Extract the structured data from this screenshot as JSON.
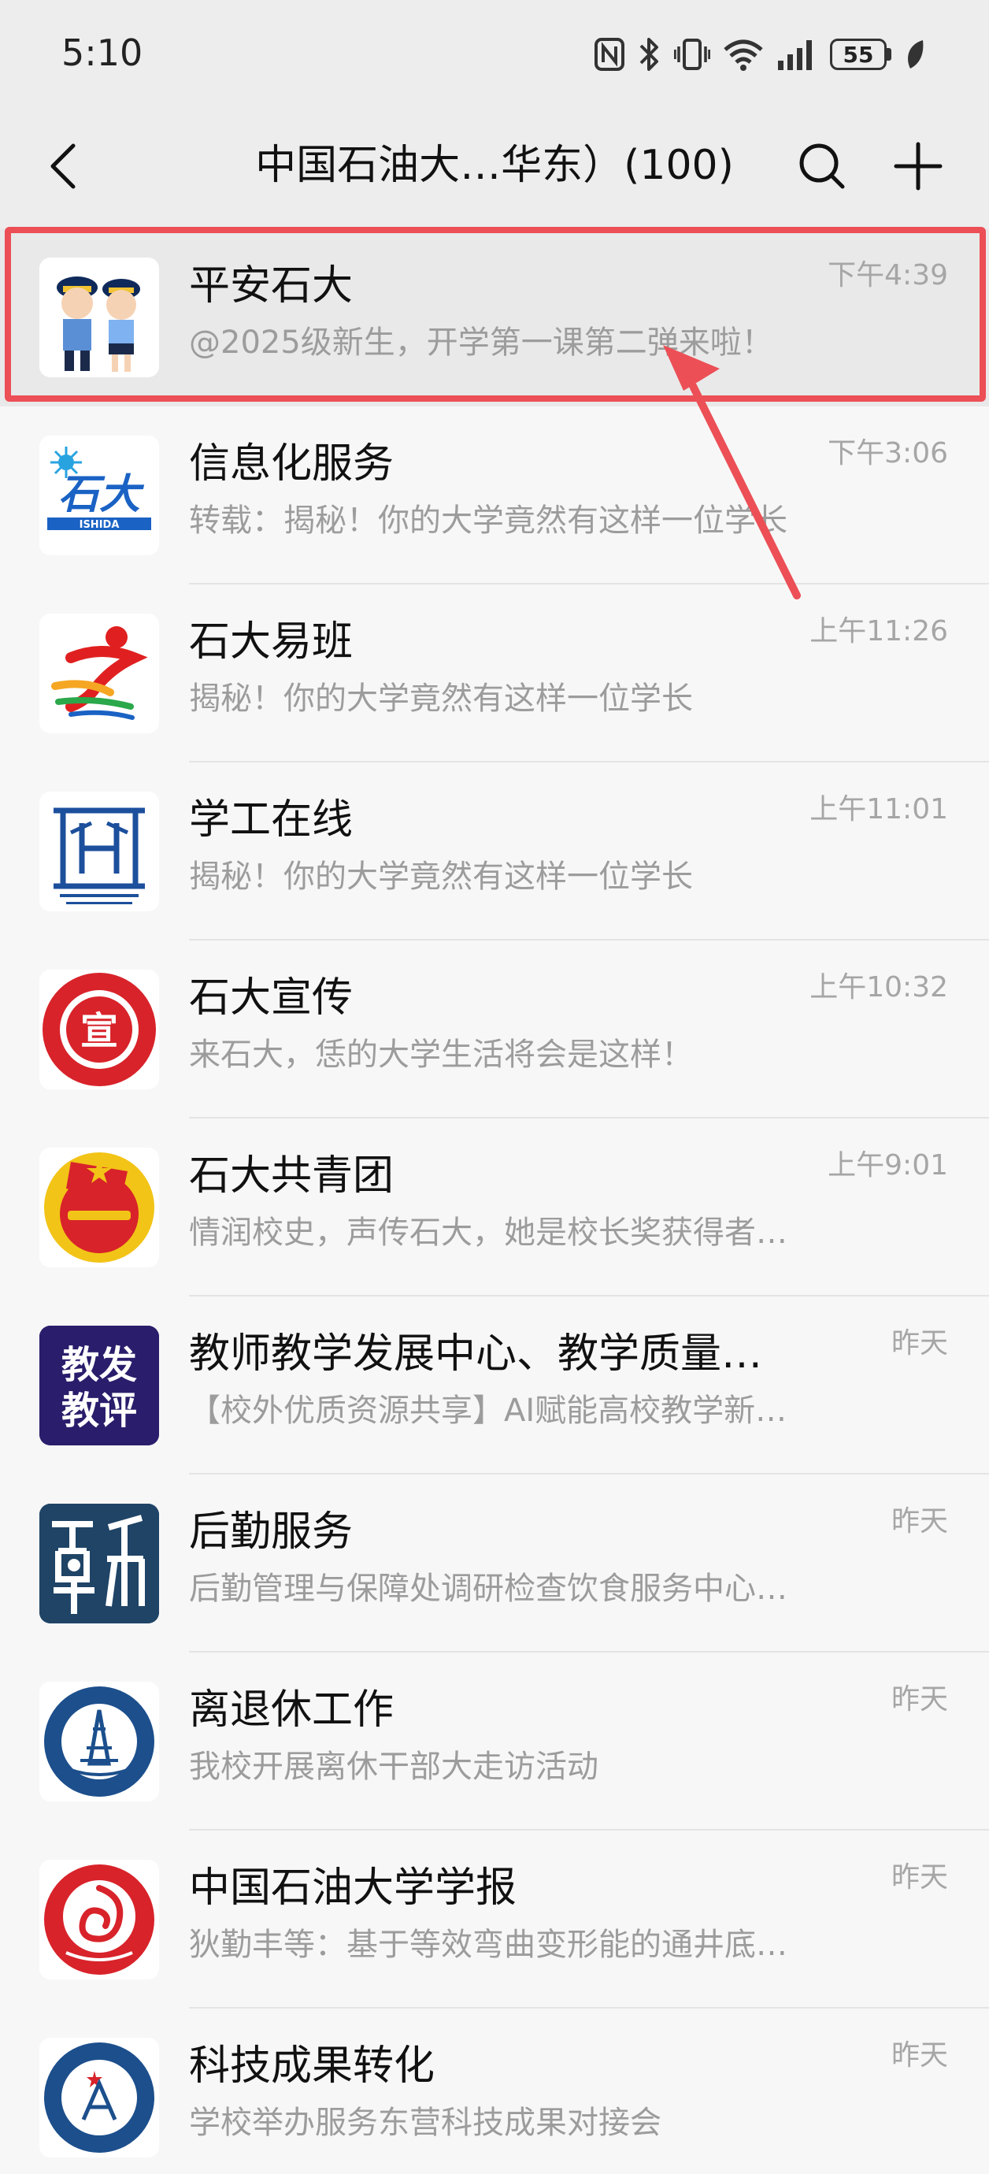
{
  "status_bar": {
    "time": "5:10",
    "battery": "55",
    "icons": [
      "nfc-icon",
      "bluetooth-icon",
      "vibrate-icon",
      "wifi-icon",
      "signal-icon",
      "battery-icon",
      "leaf-icon"
    ]
  },
  "header": {
    "title": "中国石油大…华东）(100)",
    "back_icon": "chevron-left-icon",
    "search_icon": "search-icon",
    "add_icon": "plus-icon"
  },
  "accent_colors": {
    "annotation": "#ec4f56",
    "background": "#ededed"
  },
  "accounts": [
    {
      "name": "平安石大",
      "preview": "@2025级新生，开学第一课第二弹来啦！",
      "time": "下午4:39",
      "avatar": "police-mascots-avatar"
    },
    {
      "name": "信息化服务",
      "preview": "转载：揭秘！你的大学竟然有这样一位学长",
      "time": "下午3:06",
      "avatar": "shida-logo-avatar",
      "avatar_text": "ISHIDA"
    },
    {
      "name": "石大易班",
      "preview": "揭秘！你的大学竟然有这样一位学长",
      "time": "上午11:26",
      "avatar": "runner-logo-avatar"
    },
    {
      "name": "学工在线",
      "preview": "揭秘！你的大学竟然有这样一位学长",
      "time": "上午11:01",
      "avatar": "xuegong-logo-avatar"
    },
    {
      "name": "石大宣传",
      "preview": "来石大，恁的大学生活将会是这样！",
      "time": "上午10:32",
      "avatar": "university-seal-avatar",
      "avatar_text": "宣"
    },
    {
      "name": "石大共青团",
      "preview": "情润校史，声传石大，她是校长奖获得者…",
      "time": "上午9:01",
      "avatar": "youth-league-avatar"
    },
    {
      "name": "教师教学发展中心、教学质量…",
      "preview": "【校外优质资源共享】AI赋能高校教学新…",
      "time": "昨天",
      "avatar": "teaching-text-avatar",
      "avatar_text_1": "教发",
      "avatar_text_2": "教评"
    },
    {
      "name": "后勤服务",
      "preview": "后勤管理与保障处调研检查饮食服务中心…",
      "time": "昨天",
      "avatar": "logistics-logo-avatar"
    },
    {
      "name": "离退休工作",
      "preview": "我校开展离休干部大走访活动",
      "time": "昨天",
      "avatar": "petroleum-seal-avatar"
    },
    {
      "name": "中国石油大学学报",
      "preview": "狄勤丰等：基于等效弯曲变形能的通井底…",
      "time": "昨天",
      "avatar": "journal-logo-avatar"
    },
    {
      "name": "科技成果转化",
      "preview": "学校举办服务东营科技成果对接会",
      "time": "昨天",
      "avatar": "tech-transfer-seal-avatar"
    }
  ]
}
